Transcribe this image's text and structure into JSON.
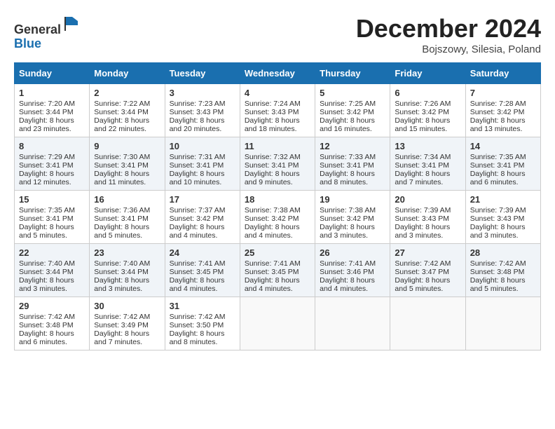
{
  "header": {
    "logo_line1": "General",
    "logo_line2": "Blue",
    "month": "December 2024",
    "location": "Bojszowy, Silesia, Poland"
  },
  "days_of_week": [
    "Sunday",
    "Monday",
    "Tuesday",
    "Wednesday",
    "Thursday",
    "Friday",
    "Saturday"
  ],
  "weeks": [
    [
      {
        "day": 1,
        "info": [
          "Sunrise: 7:20 AM",
          "Sunset: 3:44 PM",
          "Daylight: 8 hours",
          "and 23 minutes."
        ]
      },
      {
        "day": 2,
        "info": [
          "Sunrise: 7:22 AM",
          "Sunset: 3:44 PM",
          "Daylight: 8 hours",
          "and 22 minutes."
        ]
      },
      {
        "day": 3,
        "info": [
          "Sunrise: 7:23 AM",
          "Sunset: 3:43 PM",
          "Daylight: 8 hours",
          "and 20 minutes."
        ]
      },
      {
        "day": 4,
        "info": [
          "Sunrise: 7:24 AM",
          "Sunset: 3:43 PM",
          "Daylight: 8 hours",
          "and 18 minutes."
        ]
      },
      {
        "day": 5,
        "info": [
          "Sunrise: 7:25 AM",
          "Sunset: 3:42 PM",
          "Daylight: 8 hours",
          "and 16 minutes."
        ]
      },
      {
        "day": 6,
        "info": [
          "Sunrise: 7:26 AM",
          "Sunset: 3:42 PM",
          "Daylight: 8 hours",
          "and 15 minutes."
        ]
      },
      {
        "day": 7,
        "info": [
          "Sunrise: 7:28 AM",
          "Sunset: 3:42 PM",
          "Daylight: 8 hours",
          "and 13 minutes."
        ]
      }
    ],
    [
      {
        "day": 8,
        "info": [
          "Sunrise: 7:29 AM",
          "Sunset: 3:41 PM",
          "Daylight: 8 hours",
          "and 12 minutes."
        ]
      },
      {
        "day": 9,
        "info": [
          "Sunrise: 7:30 AM",
          "Sunset: 3:41 PM",
          "Daylight: 8 hours",
          "and 11 minutes."
        ]
      },
      {
        "day": 10,
        "info": [
          "Sunrise: 7:31 AM",
          "Sunset: 3:41 PM",
          "Daylight: 8 hours",
          "and 10 minutes."
        ]
      },
      {
        "day": 11,
        "info": [
          "Sunrise: 7:32 AM",
          "Sunset: 3:41 PM",
          "Daylight: 8 hours",
          "and 9 minutes."
        ]
      },
      {
        "day": 12,
        "info": [
          "Sunrise: 7:33 AM",
          "Sunset: 3:41 PM",
          "Daylight: 8 hours",
          "and 8 minutes."
        ]
      },
      {
        "day": 13,
        "info": [
          "Sunrise: 7:34 AM",
          "Sunset: 3:41 PM",
          "Daylight: 8 hours",
          "and 7 minutes."
        ]
      },
      {
        "day": 14,
        "info": [
          "Sunrise: 7:35 AM",
          "Sunset: 3:41 PM",
          "Daylight: 8 hours",
          "and 6 minutes."
        ]
      }
    ],
    [
      {
        "day": 15,
        "info": [
          "Sunrise: 7:35 AM",
          "Sunset: 3:41 PM",
          "Daylight: 8 hours",
          "and 5 minutes."
        ]
      },
      {
        "day": 16,
        "info": [
          "Sunrise: 7:36 AM",
          "Sunset: 3:41 PM",
          "Daylight: 8 hours",
          "and 5 minutes."
        ]
      },
      {
        "day": 17,
        "info": [
          "Sunrise: 7:37 AM",
          "Sunset: 3:42 PM",
          "Daylight: 8 hours",
          "and 4 minutes."
        ]
      },
      {
        "day": 18,
        "info": [
          "Sunrise: 7:38 AM",
          "Sunset: 3:42 PM",
          "Daylight: 8 hours",
          "and 4 minutes."
        ]
      },
      {
        "day": 19,
        "info": [
          "Sunrise: 7:38 AM",
          "Sunset: 3:42 PM",
          "Daylight: 8 hours",
          "and 3 minutes."
        ]
      },
      {
        "day": 20,
        "info": [
          "Sunrise: 7:39 AM",
          "Sunset: 3:43 PM",
          "Daylight: 8 hours",
          "and 3 minutes."
        ]
      },
      {
        "day": 21,
        "info": [
          "Sunrise: 7:39 AM",
          "Sunset: 3:43 PM",
          "Daylight: 8 hours",
          "and 3 minutes."
        ]
      }
    ],
    [
      {
        "day": 22,
        "info": [
          "Sunrise: 7:40 AM",
          "Sunset: 3:44 PM",
          "Daylight: 8 hours",
          "and 3 minutes."
        ]
      },
      {
        "day": 23,
        "info": [
          "Sunrise: 7:40 AM",
          "Sunset: 3:44 PM",
          "Daylight: 8 hours",
          "and 3 minutes."
        ]
      },
      {
        "day": 24,
        "info": [
          "Sunrise: 7:41 AM",
          "Sunset: 3:45 PM",
          "Daylight: 8 hours",
          "and 4 minutes."
        ]
      },
      {
        "day": 25,
        "info": [
          "Sunrise: 7:41 AM",
          "Sunset: 3:45 PM",
          "Daylight: 8 hours",
          "and 4 minutes."
        ]
      },
      {
        "day": 26,
        "info": [
          "Sunrise: 7:41 AM",
          "Sunset: 3:46 PM",
          "Daylight: 8 hours",
          "and 4 minutes."
        ]
      },
      {
        "day": 27,
        "info": [
          "Sunrise: 7:42 AM",
          "Sunset: 3:47 PM",
          "Daylight: 8 hours",
          "and 5 minutes."
        ]
      },
      {
        "day": 28,
        "info": [
          "Sunrise: 7:42 AM",
          "Sunset: 3:48 PM",
          "Daylight: 8 hours",
          "and 5 minutes."
        ]
      }
    ],
    [
      {
        "day": 29,
        "info": [
          "Sunrise: 7:42 AM",
          "Sunset: 3:48 PM",
          "Daylight: 8 hours",
          "and 6 minutes."
        ]
      },
      {
        "day": 30,
        "info": [
          "Sunrise: 7:42 AM",
          "Sunset: 3:49 PM",
          "Daylight: 8 hours",
          "and 7 minutes."
        ]
      },
      {
        "day": 31,
        "info": [
          "Sunrise: 7:42 AM",
          "Sunset: 3:50 PM",
          "Daylight: 8 hours",
          "and 8 minutes."
        ]
      },
      null,
      null,
      null,
      null
    ]
  ]
}
